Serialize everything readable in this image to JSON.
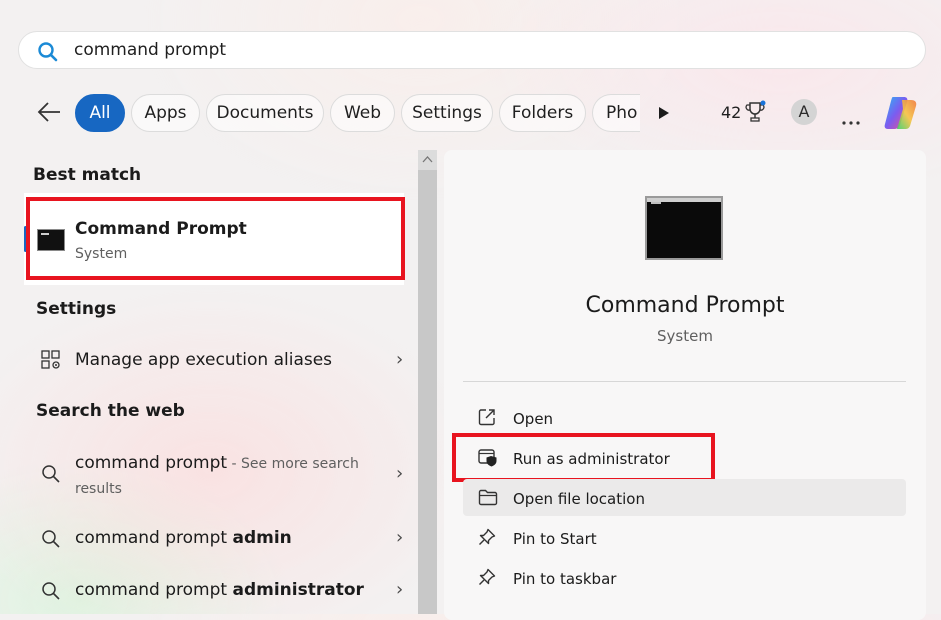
{
  "search": {
    "query": "command prompt"
  },
  "filters": {
    "back_label": "Back",
    "chips": [
      "All",
      "Apps",
      "Documents",
      "Web",
      "Settings",
      "Folders",
      "Pho"
    ],
    "points": "42",
    "avatar_initial": "A",
    "more": "⋯"
  },
  "results": {
    "best_match_heading": "Best match",
    "best_match": {
      "title": "Command Prompt",
      "subtitle": "System"
    },
    "settings_heading": "Settings",
    "settings_items": [
      {
        "label": "Manage app execution aliases"
      }
    ],
    "web_heading": "Search the web",
    "web_items": [
      {
        "query": "command prompt",
        "suffix": " - See more search",
        "suffix2": "results"
      },
      {
        "query": "command prompt ",
        "bold": "admin"
      },
      {
        "query": "command prompt ",
        "bold": "administrator"
      }
    ]
  },
  "detail": {
    "title": "Command Prompt",
    "subtitle": "System",
    "actions": [
      {
        "label": "Open",
        "icon": "open-external-icon"
      },
      {
        "label": "Run as administrator",
        "icon": "shield-admin-icon"
      },
      {
        "label": "Open file location",
        "icon": "folder-icon"
      },
      {
        "label": "Pin to Start",
        "icon": "pin-icon"
      },
      {
        "label": "Pin to taskbar",
        "icon": "pin-icon"
      }
    ]
  },
  "colors": {
    "accent": "#1767c2",
    "highlight_box": "#e8141f"
  }
}
